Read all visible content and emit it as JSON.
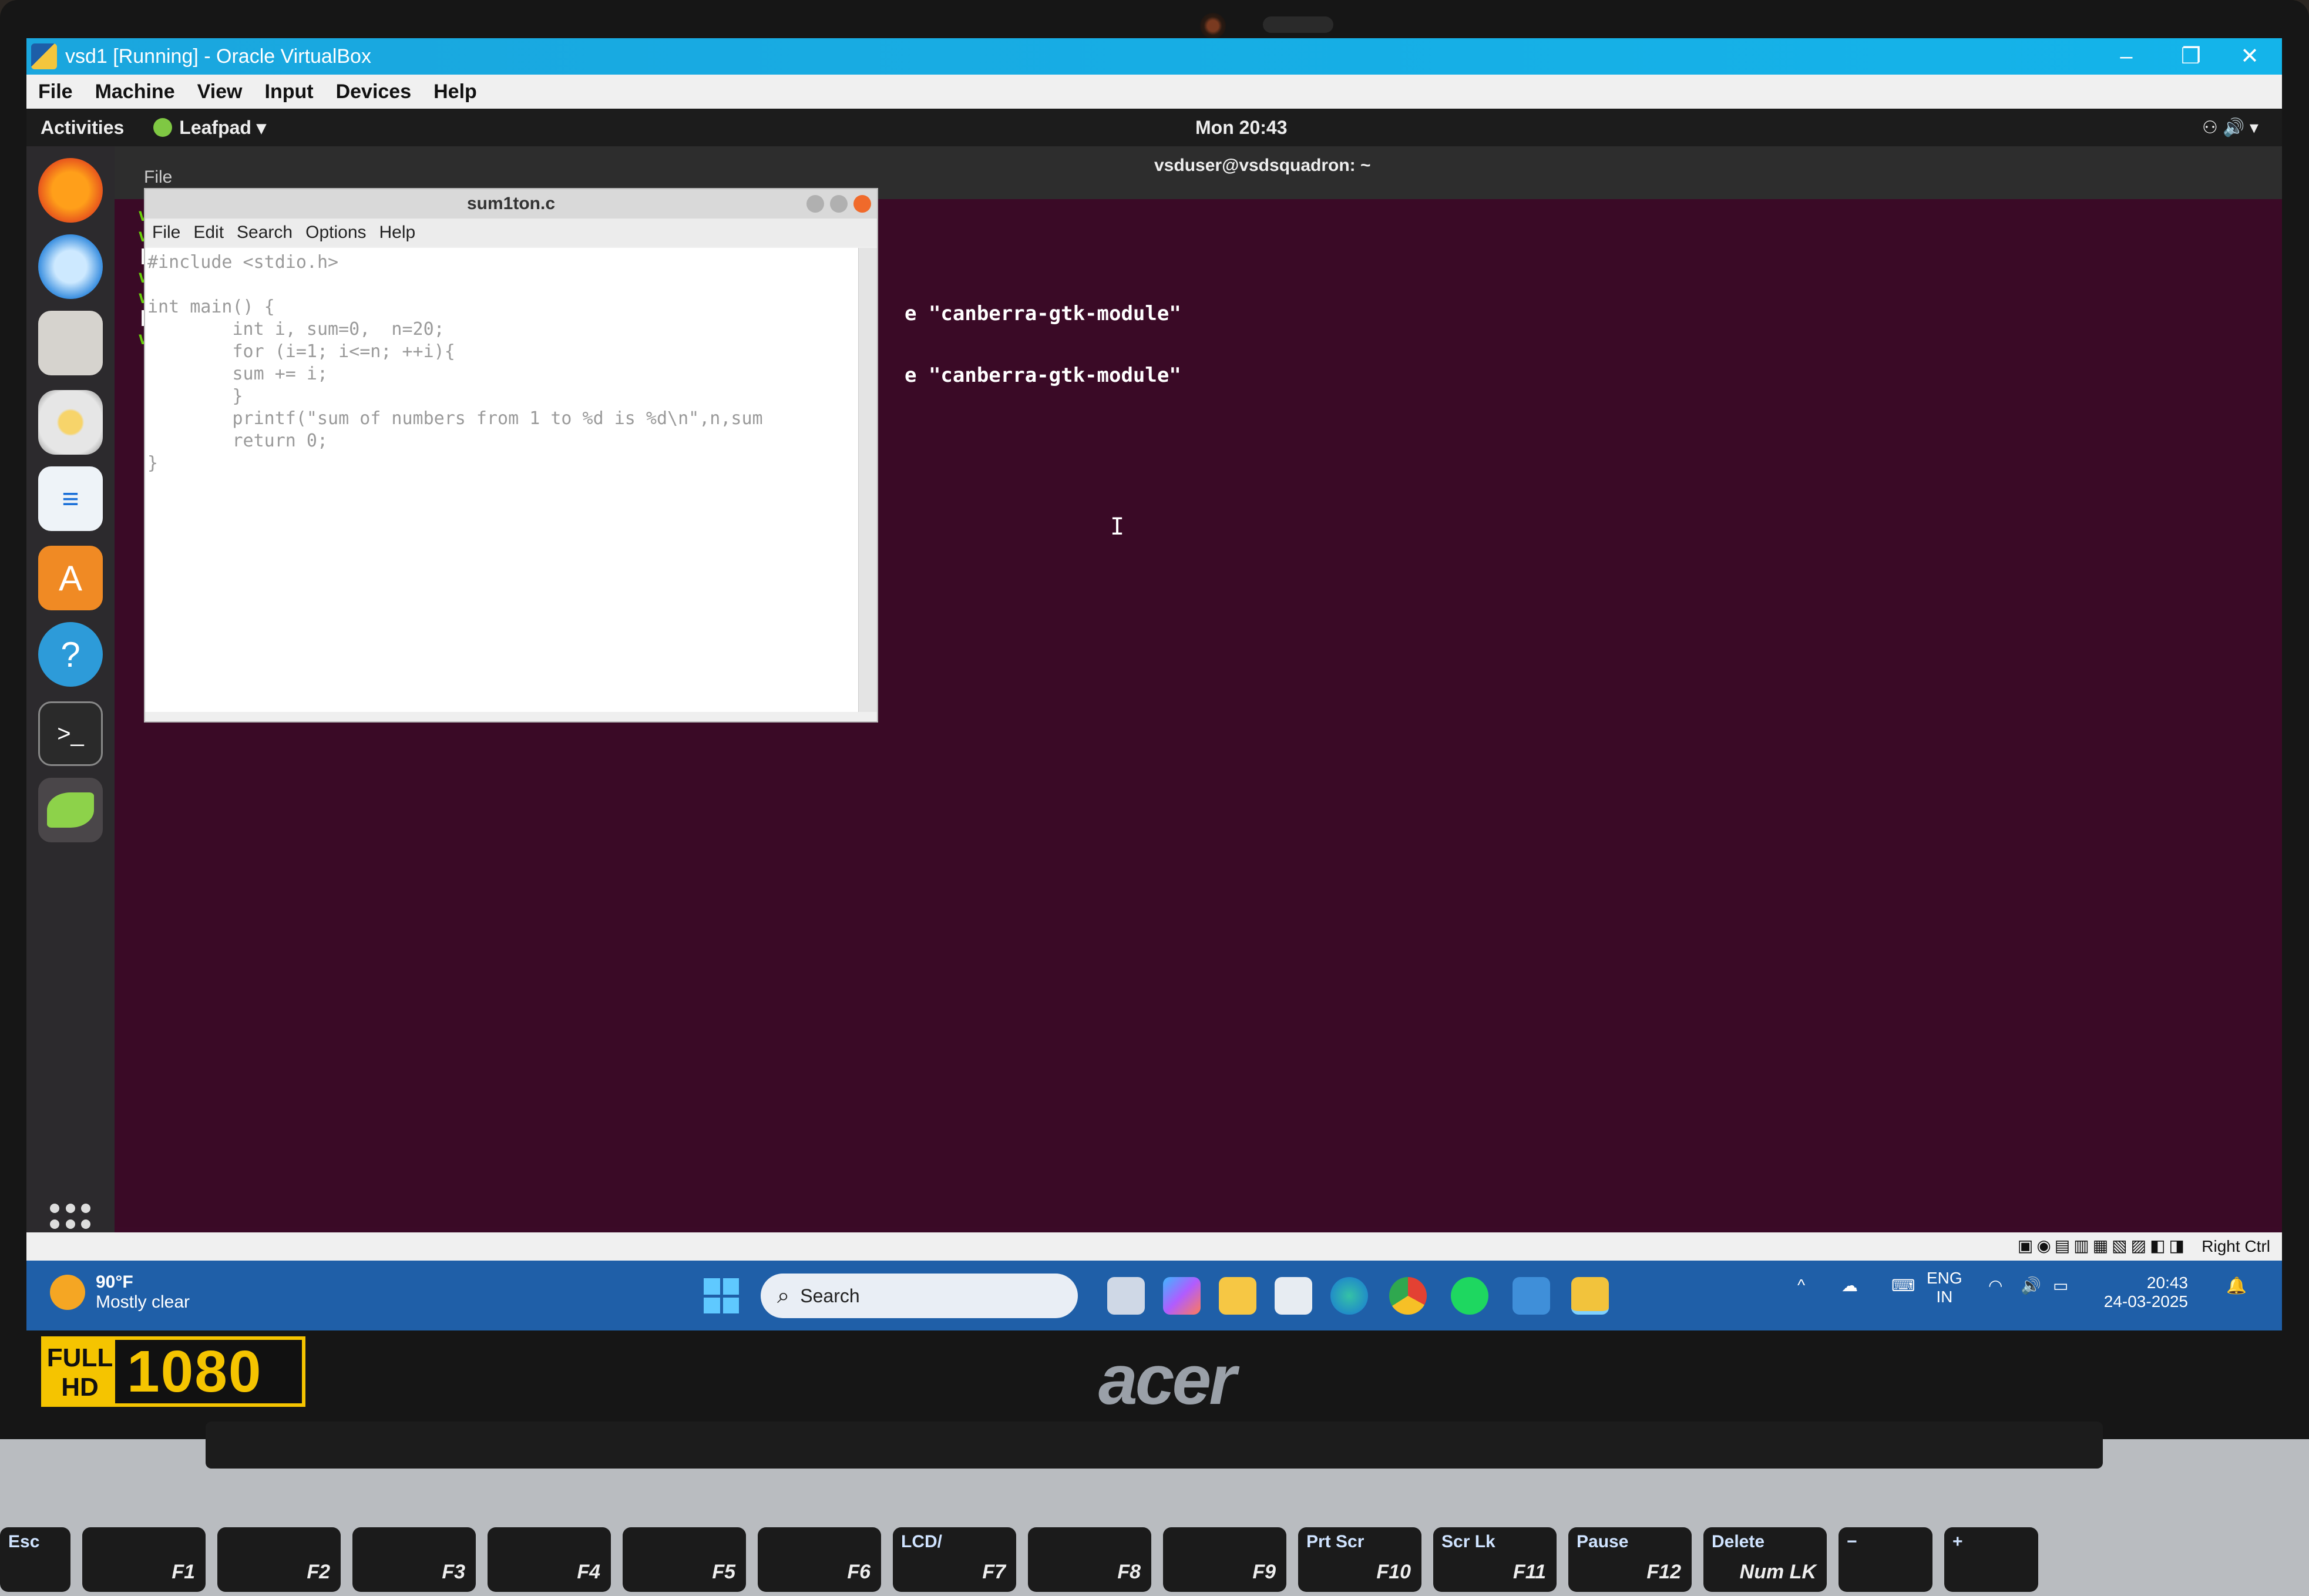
{
  "vbox": {
    "title": "vsd1 [Running] - Oracle VirtualBox",
    "menu": [
      "File",
      "Machine",
      "View",
      "Input",
      "Devices",
      "Help"
    ],
    "status_right": "Right Ctrl"
  },
  "guest_topbar": {
    "activities": "Activities",
    "app_menu": "Leafpad ▾",
    "clock": "Mon 20:43"
  },
  "dock": {
    "items": [
      "firefox-icon",
      "thunderbird-icon",
      "files-icon",
      "rhythmbox-icon",
      "libreoffice-writer-icon",
      "software-icon",
      "help-icon",
      "terminal-icon",
      "leafpad-icon"
    ]
  },
  "terminal": {
    "title": "vsduser@vsdsquadron: ~",
    "menu_file": "File",
    "prompt_fragments": [
      "vsd",
      "vsd",
      "[1]",
      "vsd",
      "vsd",
      "[2]",
      "vsd"
    ],
    "lines": [
      "e \"canberra-gtk-module\"",
      "e \"canberra-gtk-module\""
    ]
  },
  "leafpad": {
    "title": "sum1ton.c",
    "menu": [
      "File",
      "Edit",
      "Search",
      "Options",
      "Help"
    ],
    "code": "#include <stdio.h>\n\nint main() {\n        int i, sum=0,  n=20;\n        for (i=1; i<=n; ++i){\n        sum += i;\n        }\n        printf(\"sum of numbers from 1 to %d is %d\\n\",n,sum\n        return 0;\n}"
  },
  "taskbar": {
    "weather_temp": "90°F",
    "weather_desc": "Mostly clear",
    "search_label": "Search",
    "lang_top": "ENG",
    "lang_bottom": "IN",
    "time": "20:43",
    "date": "24-03-2025",
    "apps": [
      "copilot-icon",
      "file-explorer-icon",
      "store-icon",
      "edge-icon",
      "chrome-icon",
      "spotify-icon",
      "virtualbox-icon",
      "virtualbox-vm-icon"
    ]
  },
  "laptop": {
    "brand": "acer",
    "badge_top": "FULL",
    "badge_bottom": "HD",
    "badge_res": "1080"
  },
  "keyboard": {
    "keys": [
      {
        "label": "Esc",
        "sub": ""
      },
      {
        "label": "",
        "sub": "F1"
      },
      {
        "label": "",
        "sub": "F2"
      },
      {
        "label": "",
        "sub": "F3"
      },
      {
        "label": "",
        "sub": "F4"
      },
      {
        "label": "",
        "sub": "F5"
      },
      {
        "label": "",
        "sub": "F6"
      },
      {
        "label": "LCD/",
        "sub": "F7"
      },
      {
        "label": "",
        "sub": "F8"
      },
      {
        "label": "",
        "sub": "F9"
      },
      {
        "label": "Prt Scr",
        "sub": "F10"
      },
      {
        "label": "Scr Lk",
        "sub": "F11"
      },
      {
        "label": "Pause",
        "sub": "F12"
      },
      {
        "label": "Delete",
        "sub": "Num LK"
      },
      {
        "label": "−",
        "sub": ""
      },
      {
        "label": "+",
        "sub": ""
      }
    ]
  }
}
